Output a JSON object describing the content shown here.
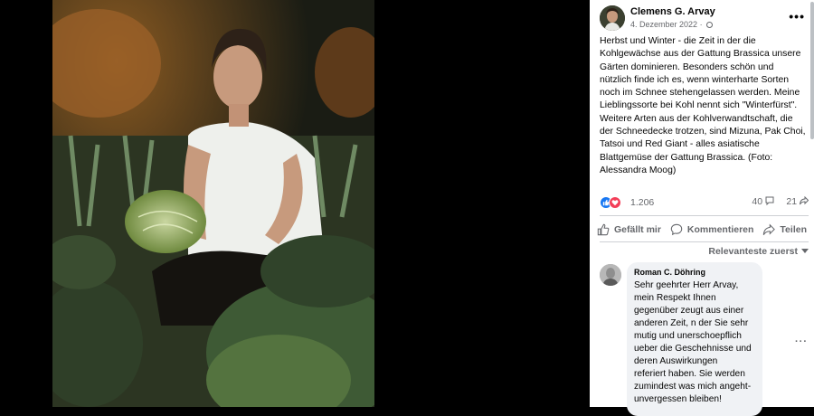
{
  "post": {
    "author": "Clemens G. Arvay",
    "date": "4. Dezember 2022",
    "date_separator": "·",
    "text": "Herbst und Winter - die Zeit in der die\nKohlgewächse aus der Gattung Brassica unsere\nGärten dominieren. Besonders schön und\nnützlich finde ich es, wenn winterharte Sorten\nnoch im Schnee stehengelassen werden. Meine\nLieblingssorte bei Kohl nennt sich \"Winterfürst\".\nWeitere Arten aus der Kohlverwandtschaft, die\nder Schneedecke trotzen, sind Mizuna, Pak Choi,\nTatsoi und Red Giant - alles asiatische\nBlattgemüse der Gattung Brassica. (Foto:\nAlessandra Moog)",
    "more_icon": "more-horizontal-icon"
  },
  "stats": {
    "reactions": "1.206",
    "comments": "40",
    "shares": "21",
    "reaction_icons": [
      "like-icon",
      "love-icon"
    ]
  },
  "actions": {
    "like": "Gefällt mir",
    "comment": "Kommentieren",
    "share": "Teilen"
  },
  "sort_label": "Relevanteste zuerst",
  "comment": {
    "author": "Roman C. Döhring",
    "text": "Sehr geehrter Herr Arvay,\nmein Respekt Ihnen\ngegenüber zeugt aus einer\nanderen Zeit, n der Sie sehr\nmutig und unerschoepflich\nueber die Geschehnisse und\nderen Auswirkungen\nreferiert haben. Sie werden\nzumindest was mich angeht-\nunvergessen bleiben!"
  },
  "colors": {
    "accent": "#1877f2",
    "love": "#f33e58",
    "muted_text": "#65676b",
    "bubble": "#f0f2f5"
  }
}
